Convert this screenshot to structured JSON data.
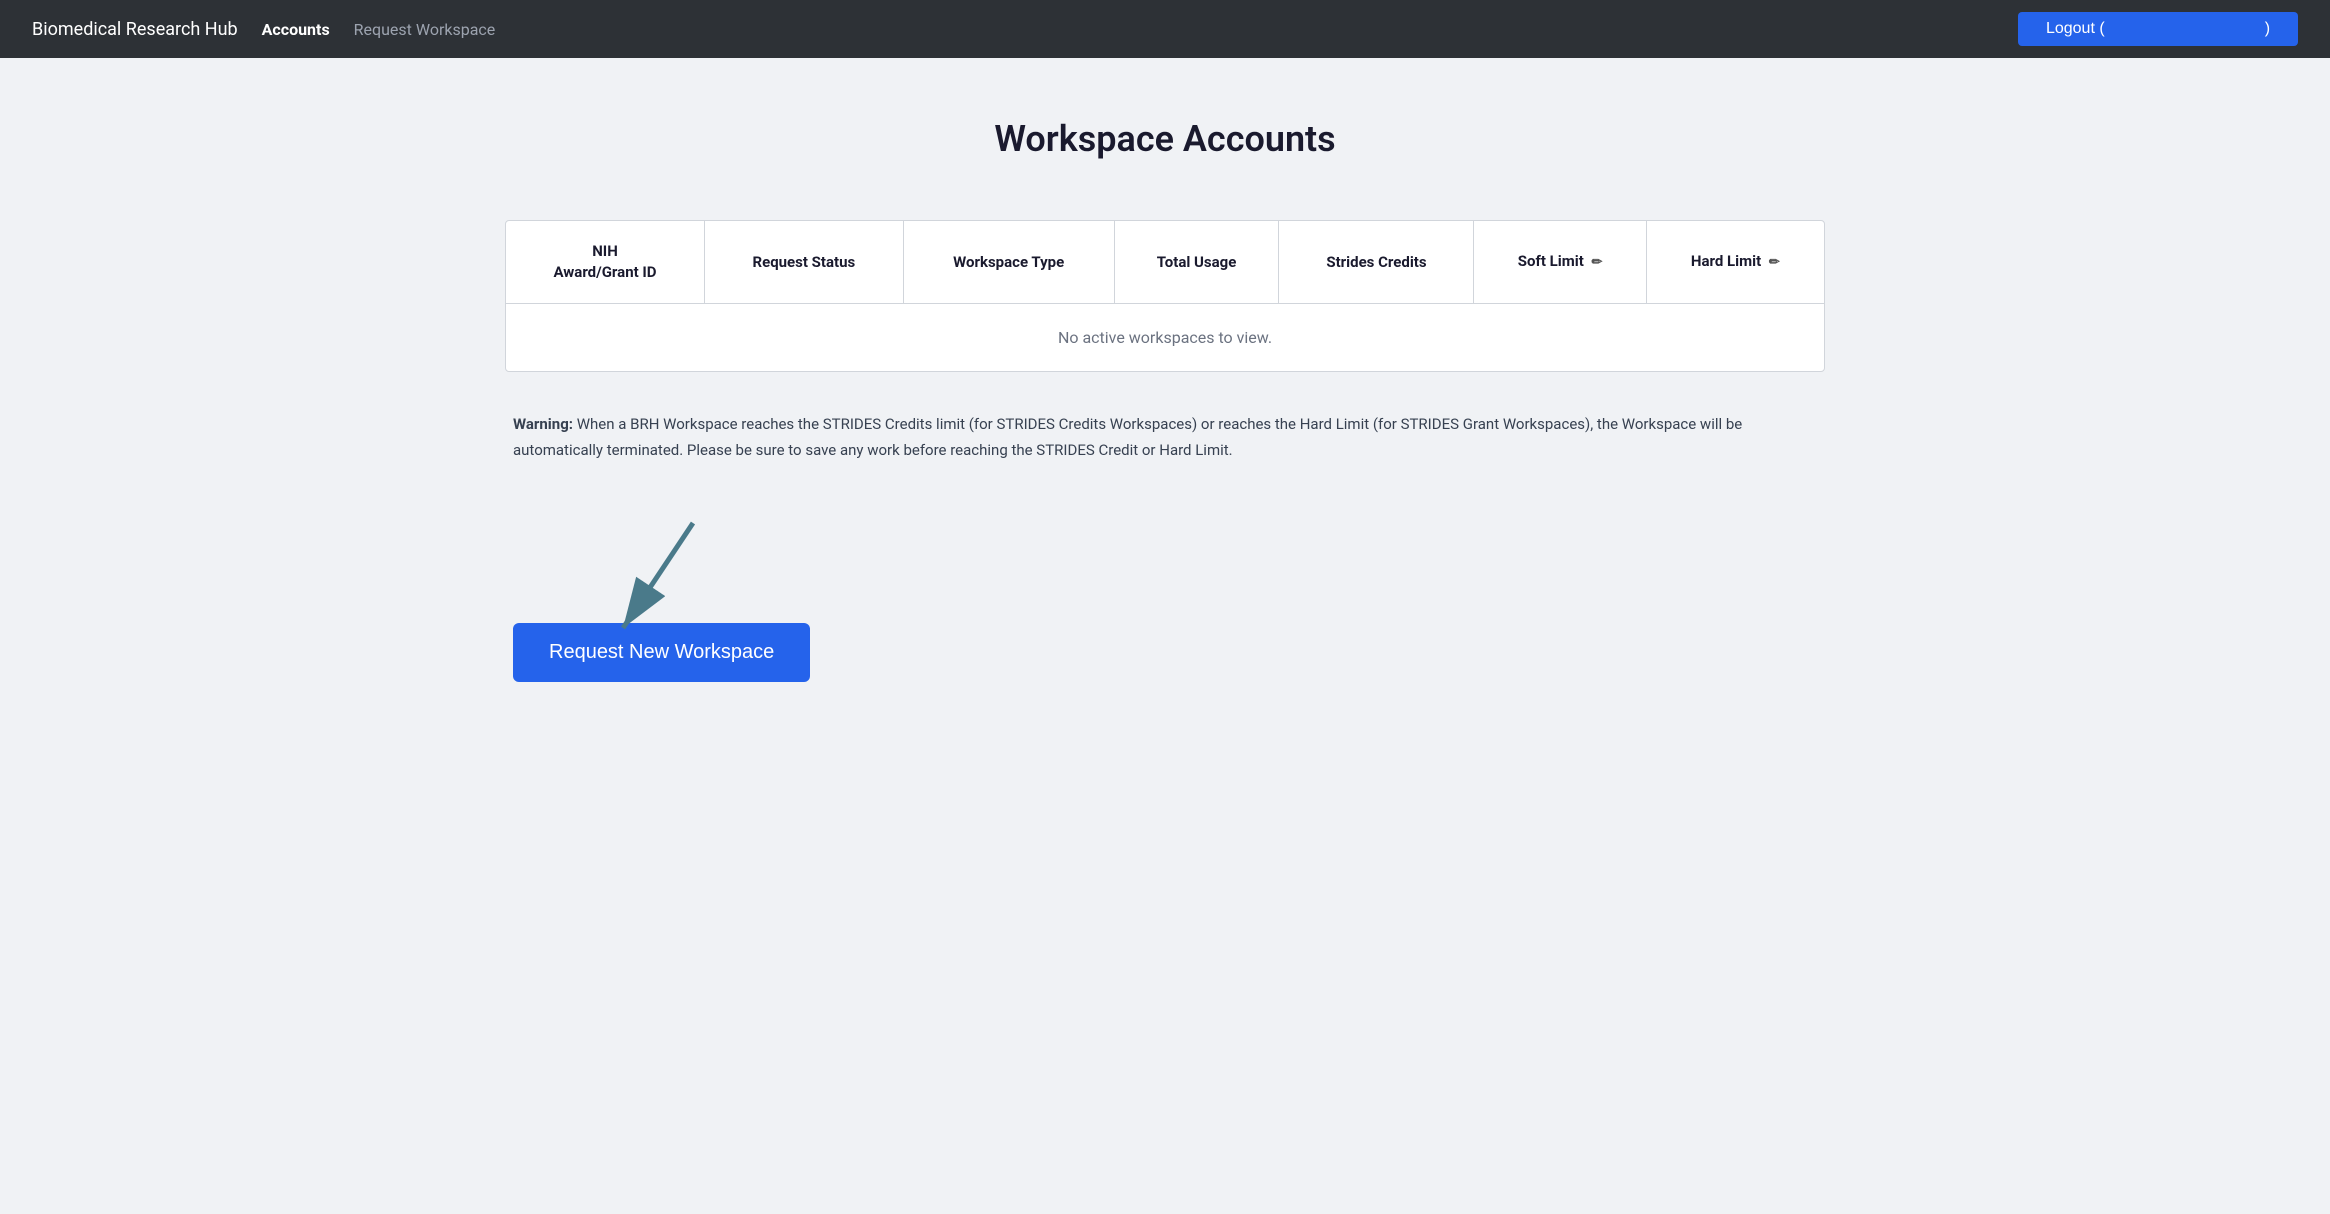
{
  "nav": {
    "brand": "Biomedical Research Hub",
    "accounts_label": "Accounts",
    "request_workspace_label": "Request Workspace",
    "logout_label": "Logout ("
  },
  "page": {
    "title": "Workspace Accounts"
  },
  "table": {
    "headers": [
      {
        "id": "nih-award",
        "label": "NIH\nAward/Grant ID",
        "edit": false
      },
      {
        "id": "request-status",
        "label": "Request Status",
        "edit": false
      },
      {
        "id": "workspace-type",
        "label": "Workspace Type",
        "edit": false
      },
      {
        "id": "total-usage",
        "label": "Total Usage",
        "edit": false
      },
      {
        "id": "strides-credits",
        "label": "Strides Credits",
        "edit": false
      },
      {
        "id": "soft-limit",
        "label": "Soft Limit",
        "edit": true
      },
      {
        "id": "hard-limit",
        "label": "Hard Limit",
        "edit": true
      }
    ],
    "empty_message": "No active workspaces to view."
  },
  "warning": {
    "bold_prefix": "Warning:",
    "text": " When a BRH Workspace reaches the STRIDES Credits limit (for STRIDES Credits Workspaces) or reaches the Hard Limit (for STRIDES Grant Workspaces), the Workspace will be automatically terminated. Please be sure to save any work before reaching the STRIDES Credit or Hard Limit."
  },
  "actions": {
    "request_new_workspace_label": "Request New Workspace"
  }
}
